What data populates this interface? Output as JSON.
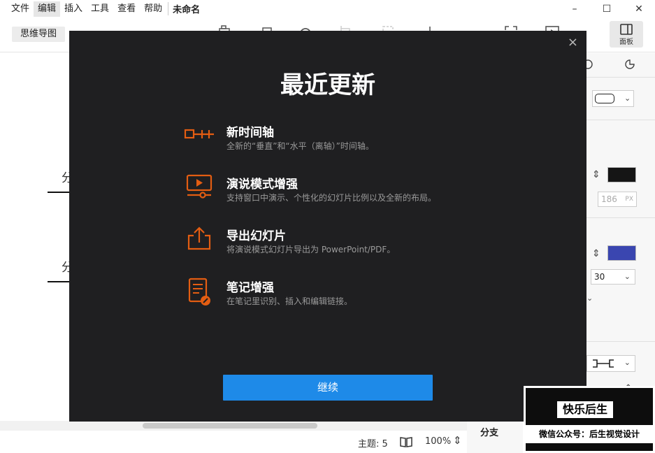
{
  "menubar": {
    "items": [
      "文件",
      "编辑",
      "插入",
      "工具",
      "查看",
      "帮助"
    ],
    "active_index": 1,
    "doc_title": "未命名"
  },
  "window_controls": {
    "minimize": "–",
    "maximize": "☐",
    "close": "✕"
  },
  "toolbar": {
    "mode_label": "思维导图",
    "panel_label": "面板",
    "icons": [
      "topic-icon",
      "subtopic-icon",
      "relationship-icon",
      "boundary-icon",
      "summary-icon",
      "add-icon",
      "fullscreen-icon",
      "presentation-icon",
      "panel-icon"
    ]
  },
  "canvas": {
    "branches": [
      "分",
      "分"
    ]
  },
  "right_panel": {
    "line_width": "186",
    "line_width_unit": "PX",
    "font_size": "30",
    "colors": {
      "fill": "#151515",
      "accent": "#3a46b0"
    }
  },
  "statusbar": {
    "topics": "主题: 5",
    "zoom": "100%",
    "branch_label": "分支"
  },
  "modal": {
    "title": "最近更新",
    "close": "×",
    "accent_color": "#e35d12",
    "features": [
      {
        "icon": "timeline-icon",
        "name": "新时间轴",
        "desc": "全新的“垂直”和“水平（离轴）”时间轴。"
      },
      {
        "icon": "presentation-icon",
        "name": "演说模式增强",
        "desc": "支持窗口中演示、个性化的幻灯片比例以及全新的布局。"
      },
      {
        "icon": "export-icon",
        "name": "导出幻灯片",
        "desc": "将演说模式幻灯片导出为 PowerPoint/PDF。"
      },
      {
        "icon": "notes-icon",
        "name": "笔记增强",
        "desc": "在笔记里识别、插入和编辑链接。"
      }
    ],
    "continue_label": "继续"
  },
  "watermark": {
    "title": "快乐后生",
    "subtitle": "微信公众号：后生视觉设计"
  }
}
